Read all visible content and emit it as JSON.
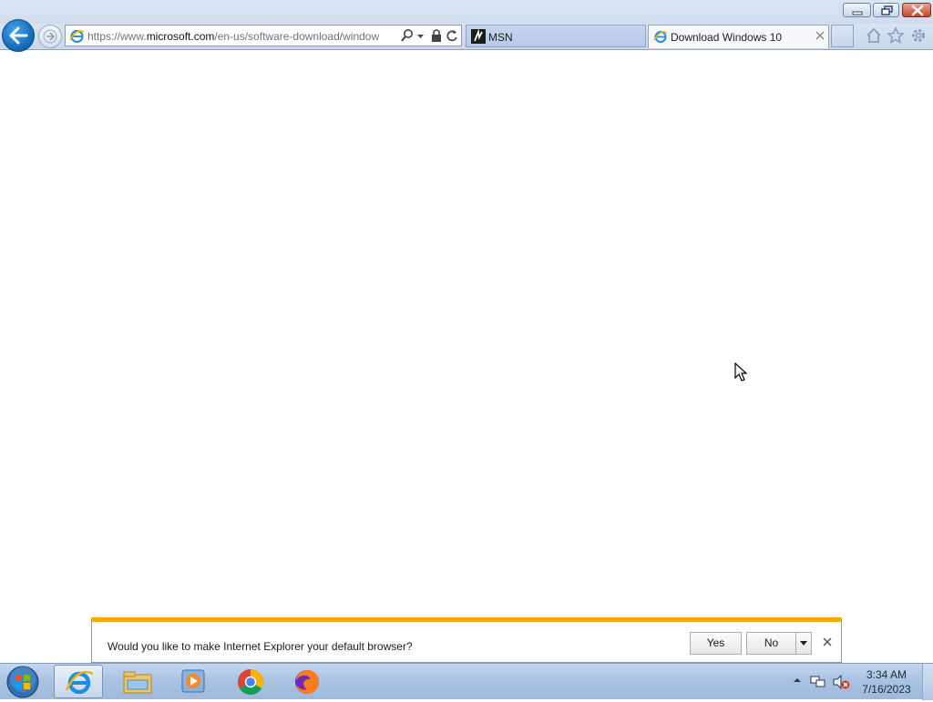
{
  "window": {
    "controls": {
      "minimize": "minimize",
      "maximize": "restore",
      "close": "close"
    }
  },
  "navigation": {
    "address_url_prefix": "https://www.",
    "address_url_domain": "microsoft.com",
    "address_url_path": "/en-us/software-download/window",
    "tabs": [
      {
        "label": "MSN",
        "active": false,
        "icon": "msn-icon"
      },
      {
        "label": "Download Windows 10",
        "active": true,
        "icon": "ie-page-icon"
      }
    ],
    "tools": [
      "home-icon",
      "favorites-star-icon",
      "settings-gear-icon"
    ]
  },
  "notification": {
    "message": "Would you like to make Internet Explorer your default browser?",
    "yes_label": "Yes",
    "no_label": "No",
    "accent_color": "#f2a900"
  },
  "taskbar": {
    "apps": [
      "internet-explorer-icon",
      "file-explorer-icon",
      "media-player-icon",
      "chrome-icon",
      "firefox-icon"
    ],
    "clock_time": "3:34 AM",
    "clock_date": "7/16/2023"
  },
  "colors": {
    "back_button": "#0f66b5",
    "close_button": "#c7452a",
    "taskbar": "#aac3e2"
  }
}
